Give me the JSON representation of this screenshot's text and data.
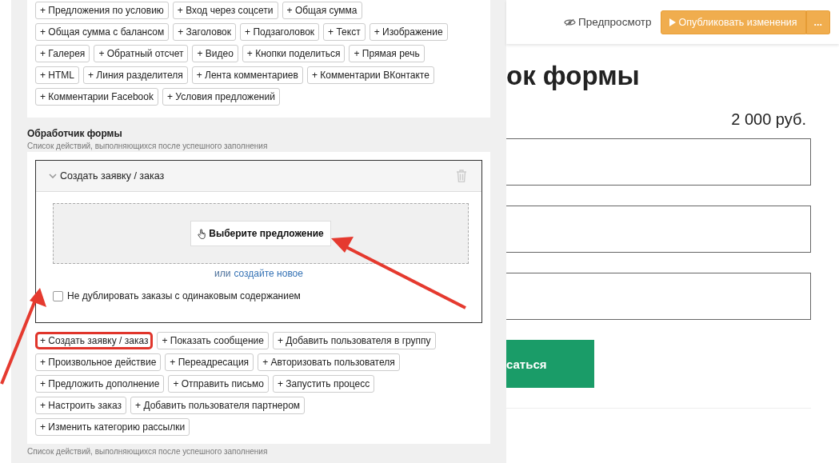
{
  "palette_rows": [
    [
      "+ Предложения по условию",
      "+ Вход через соцсети",
      "+ Общая сумма"
    ],
    [
      "+ Общая сумма с балансом",
      "+ Заголовок",
      "+ Подзаголовок",
      "+ Текст",
      "+ Изображение"
    ],
    [
      "+ Галерея",
      "+ Обратный отсчет",
      "+ Видео",
      "+ Кнопки поделиться",
      "+ Прямая речь"
    ],
    [
      "+ HTML",
      "+ Линия разделителя",
      "+ Лента комментариев",
      "+ Комментарии ВКонтакте"
    ],
    [
      "+ Комментарии Facebook",
      "+ Условия предложений"
    ]
  ],
  "handler": {
    "title": "Обработчик формы",
    "subtitle": "Список действий, выполняющихся после успешного заполнения",
    "action": {
      "title": "Создать заявку / заказ",
      "expanded": true,
      "choose_button": "Выберите предложение",
      "create_prefix": "или",
      "create_link": "создайте новое",
      "checkbox": {
        "label": "Не дублировать заказы с одинаковым содержанием",
        "checked": false
      }
    },
    "action_rows": [
      [
        {
          "label": "+ Создать заявку / заказ",
          "highlighted": true
        },
        {
          "label": "+ Показать сообщение",
          "highlighted": false
        },
        {
          "label": "+ Добавить пользователя в группу",
          "highlighted": false
        }
      ],
      [
        {
          "label": "+ Произвольное действие",
          "highlighted": false
        },
        {
          "label": "+ Переадресация",
          "highlighted": false
        },
        {
          "label": "+ Авторизовать пользователя",
          "highlighted": false
        }
      ],
      [
        {
          "label": "+ Предложить дополнение",
          "highlighted": false
        },
        {
          "label": "+ Отправить письмо",
          "highlighted": false
        },
        {
          "label": "+ Запустить процесс",
          "highlighted": false
        }
      ],
      [
        {
          "label": "+ Настроить заказ",
          "highlighted": false
        },
        {
          "label": "+ Добавить пользователя партнером",
          "highlighted": false
        }
      ],
      [
        {
          "label": "+ Изменить категорию рассылки",
          "highlighted": false
        }
      ]
    ],
    "footer_note": "Список действий, выполняющихся после успешного заполнения"
  },
  "topbar": {
    "preview": "Предпросмотр",
    "publish": "Опубликовать изменения",
    "more": "..."
  },
  "preview_page": {
    "title": "ок формы",
    "price": "2 000 руб.",
    "submit": "саться"
  }
}
